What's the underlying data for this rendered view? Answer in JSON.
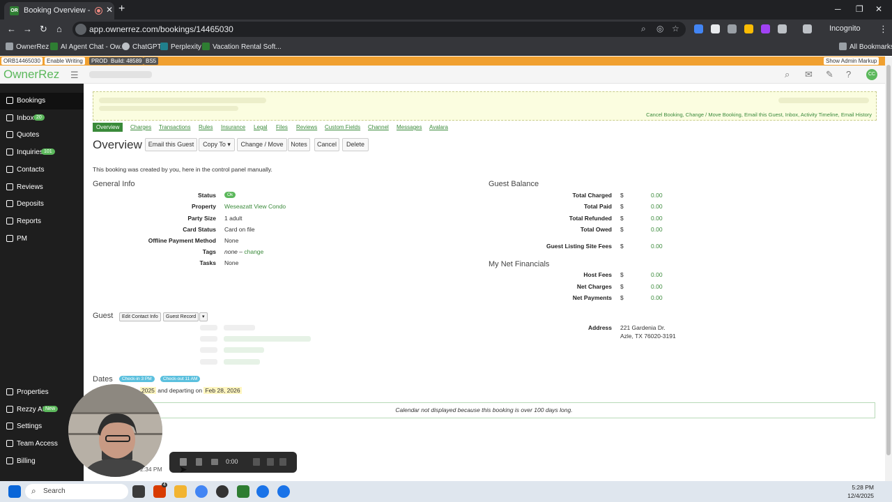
{
  "browser": {
    "tab_title": "Booking Overview - Booking",
    "tab_favicon": "OR",
    "url": "app.ownerrez.com/bookings/14465030",
    "incognito_label": "Incognito",
    "bookmarks": [
      "OwnerRez",
      "AI Agent Chat - Ow...",
      "ChatGPT",
      "Perplexity",
      "Vacation Rental Soft..."
    ],
    "all_bookmarks": "All Bookmarks"
  },
  "admin_bar": {
    "booking_code": "ORB14465030",
    "enable_writing": "Enable Writing",
    "env": "PROD",
    "build": "Build: 48589",
    "bs": "BS5",
    "show_markup": "Show Admin Markup"
  },
  "app": {
    "logo": "OwnerRez",
    "avatar": "CC",
    "accent": "#5cb85c"
  },
  "sidebar": {
    "items": [
      {
        "label": "Bookings",
        "icon": "bookings-icon"
      },
      {
        "label": "Inbox",
        "badge": "20",
        "icon": "inbox-icon"
      },
      {
        "label": "Quotes",
        "icon": "quotes-icon"
      },
      {
        "label": "Inquiries",
        "badge": "101",
        "icon": "inquiries-icon"
      },
      {
        "label": "Contacts",
        "icon": "contacts-icon"
      },
      {
        "label": "Reviews",
        "icon": "reviews-icon"
      },
      {
        "label": "Deposits",
        "icon": "deposits-icon"
      },
      {
        "label": "Reports",
        "icon": "reports-icon"
      },
      {
        "label": "PM",
        "icon": "pm-icon"
      }
    ],
    "bottom_items": [
      {
        "label": "Properties",
        "icon": "properties-icon"
      },
      {
        "label": "Rezzy AI",
        "badge": "New",
        "icon": "rezzy-icon"
      },
      {
        "label": "Settings",
        "icon": "settings-icon"
      },
      {
        "label": "Team Access",
        "icon": "team-icon"
      },
      {
        "label": "Billing",
        "icon": "billing-icon"
      }
    ]
  },
  "banner_links": "Cancel Booking, Change / Move Booking, Email this Guest, Inbox, Activity Timeline, Email History",
  "subnav": [
    "Overview",
    "Charges",
    "Transactions",
    "Rules",
    "Insurance",
    "Legal",
    "Files",
    "Reviews",
    "Custom Fields",
    "Channel",
    "Messages",
    "Avalara"
  ],
  "page": {
    "title": "Overview",
    "buttons": [
      "Email this Guest",
      "Copy To ▾",
      "Change / Move",
      "Notes",
      "Cancel",
      "Delete"
    ],
    "note": "This booking was created by you, here in the control panel manually."
  },
  "general_info": {
    "title": "General Info",
    "status_label": "Status",
    "status_value": "Ok",
    "property_label": "Property",
    "property_value": "Weseazatt View Condo",
    "party_label": "Party Size",
    "party_value": "1 adult",
    "card_label": "Card Status",
    "card_value": "Card on file",
    "offline_label": "Offline Payment Method",
    "offline_value": "None",
    "tags_label": "Tags",
    "tags_value": "none",
    "tags_sep": " – ",
    "tags_change": "change",
    "tasks_label": "Tasks",
    "tasks_value": "None"
  },
  "guest_balance": {
    "title": "Guest Balance",
    "rows": [
      {
        "label": "Total Charged",
        "currency": "$",
        "amount": "0.00"
      },
      {
        "label": "Total Paid",
        "currency": "$",
        "amount": "0.00"
      },
      {
        "label": "Total Refunded",
        "currency": "$",
        "amount": "0.00"
      },
      {
        "label": "Total Owed",
        "currency": "$",
        "amount": "0.00"
      },
      {
        "label": "Guest Listing Site Fees",
        "currency": "$",
        "amount": "0.00"
      }
    ]
  },
  "net_financials": {
    "title": "My Net Financials",
    "rows": [
      {
        "label": "Host Fees",
        "currency": "$",
        "amount": "0.00"
      },
      {
        "label": "Net Charges",
        "currency": "$",
        "amount": "0.00"
      },
      {
        "label": "Net Payments",
        "currency": "$",
        "amount": "0.00"
      }
    ]
  },
  "guest": {
    "title": "Guest",
    "edit_contact": "Edit Contact Info",
    "guest_record": "Guest Record",
    "address_label": "Address",
    "address_line1": "221 Gardenia Dr.",
    "address_line2": "Azle, TX 76020-3191"
  },
  "dates": {
    "title": "Dates",
    "checkin": "Check-in 3 PM",
    "checkout": "Check-out 11 AM",
    "arrival_partial": "2025",
    "departing_text": "and departing on",
    "departure": "Feb 28, 2026",
    "calendar_note": "Calendar not displayed because this booking is over 100 days long.",
    "footer_partial": "2:34 PM"
  },
  "recorder": {
    "time": "0:00"
  },
  "taskbar": {
    "search": "Search",
    "time": "5:28 PM",
    "date": "12/4/2025",
    "mail_badge": "4"
  }
}
